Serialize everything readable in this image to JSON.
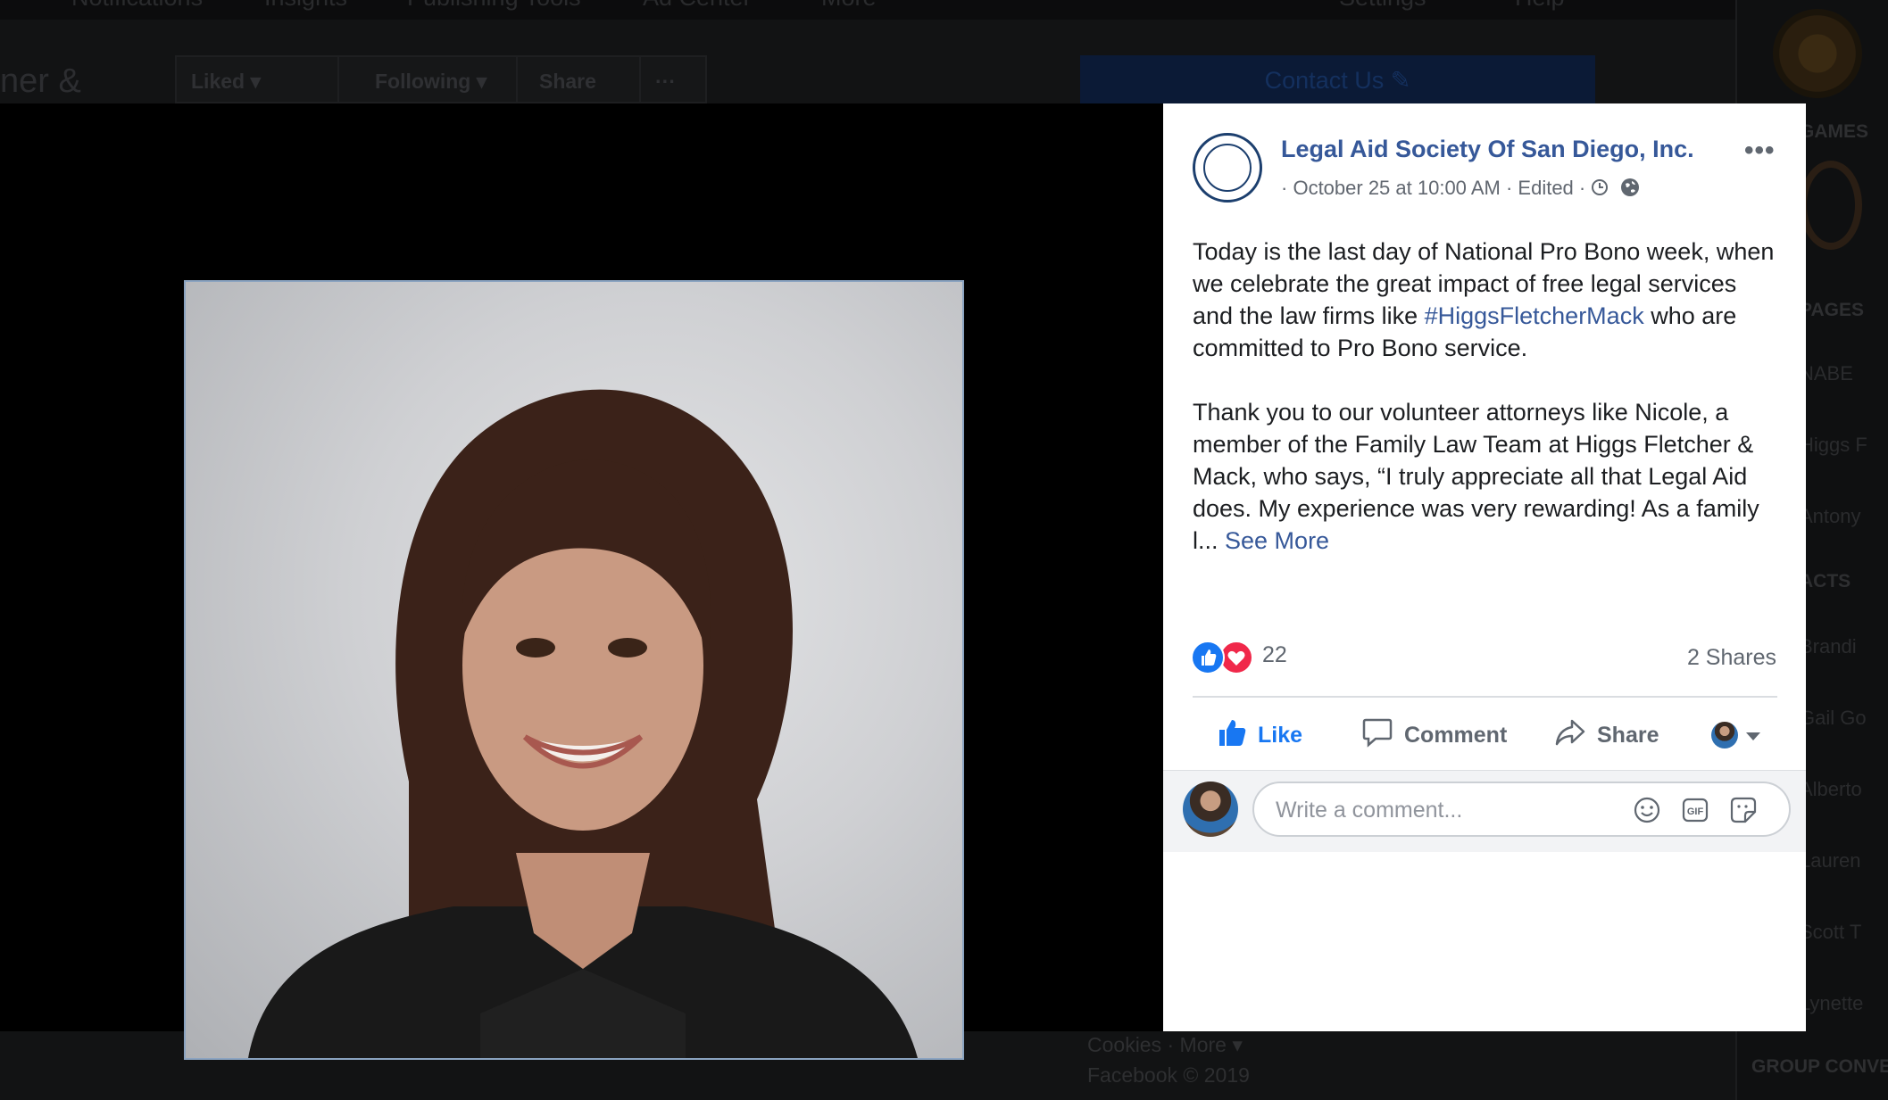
{
  "background": {
    "nav": [
      "Notifications",
      "Insights",
      "Publishing Tools",
      "Ad Center",
      "More",
      "Settings",
      "Help"
    ],
    "page_title_fragment": "ner &",
    "buttons": {
      "liked": "Liked",
      "following": "Following",
      "share": "Share",
      "more": "···"
    },
    "contact_button": "Contact Us",
    "footer": {
      "links": "Cookies · More ▾",
      "copyright": "Facebook © 2019"
    },
    "right_column": {
      "headings": [
        "GAMES",
        "PAGES",
        "ACTS",
        "GROUP CONVE"
      ],
      "names": [
        "NABE",
        "Higgs F",
        "Antony",
        "Brandi",
        "Gail Go",
        "Alberto",
        "Lauren",
        "Scott T",
        "Lynette"
      ]
    }
  },
  "post": {
    "page_name": "Legal Aid Society Of San Diego, Inc.",
    "timestamp": "October 25 at 10:00 AM",
    "edited_label": "Edited",
    "more_options": "•••",
    "text": {
      "p1_before_tag": "Today is the last day of National Pro Bono week, when we celebrate the great impact of free legal services and the law firms like ",
      "hashtag": "#HiggsFletcherMack",
      "p1_after_tag": " who are committed to Pro Bono service.",
      "p2": "Thank you to our volunteer attorneys like Nicole, a member of the Family Law Team at Higgs Fletcher & Mack, who says, “I truly appreciate all that Legal Aid does. My experience was very rewarding! As a family l... ",
      "see_more": "See More"
    },
    "reaction_count": "22",
    "shares": "2 Shares",
    "actions": {
      "like": "Like",
      "comment": "Comment",
      "share": "Share"
    },
    "comment_placeholder": "Write a comment..."
  },
  "colors": {
    "link": "#365899",
    "like_blue": "#1877f2",
    "love_red": "#f0284a",
    "muted": "#606770"
  },
  "icons": [
    "like-reaction-icon",
    "love-reaction-icon",
    "thumbs-up-icon",
    "comment-icon",
    "share-arrow-icon",
    "chevron-down-icon",
    "clock-icon",
    "globe-icon",
    "emoji-icon",
    "gif-icon",
    "sticker-icon"
  ]
}
